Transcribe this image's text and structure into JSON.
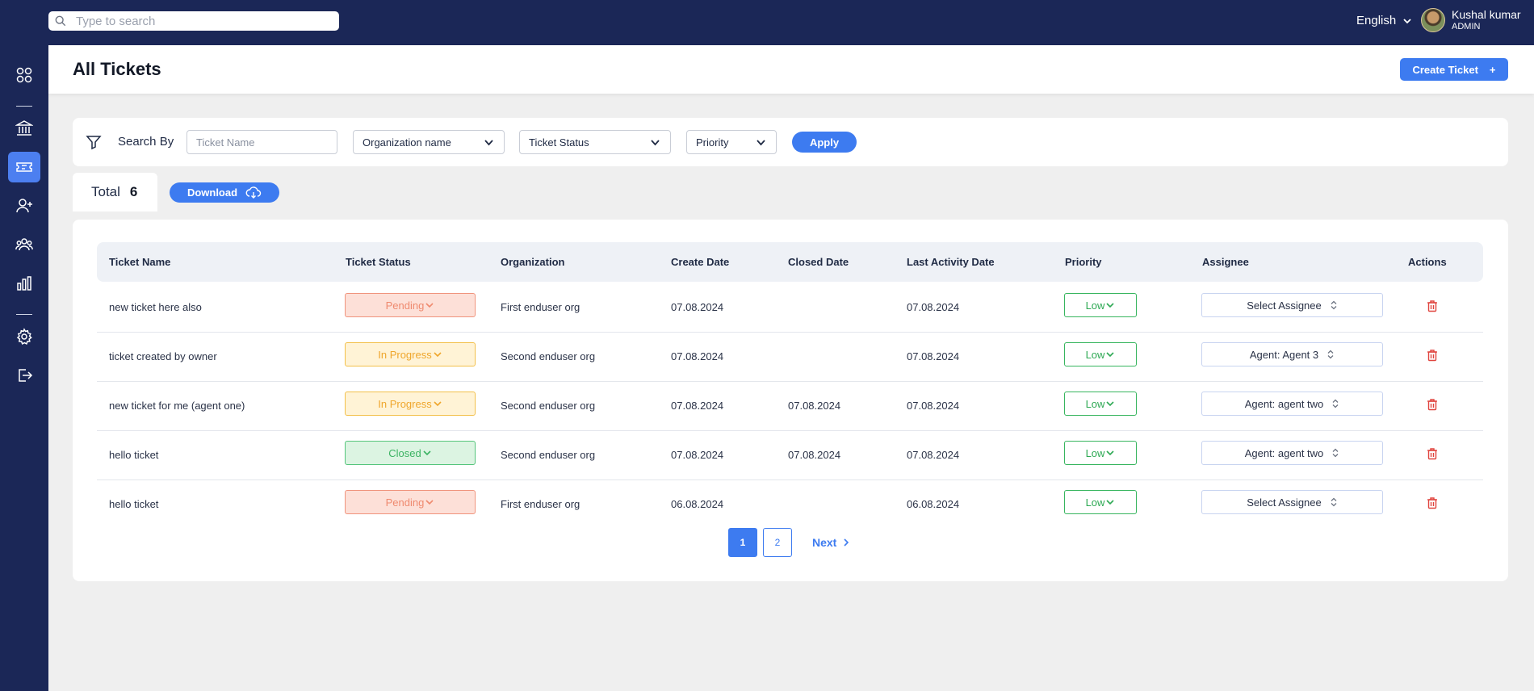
{
  "topbar": {
    "search_placeholder": "Type to search",
    "language": "English",
    "user_name": "Kushal kumar",
    "user_role": "ADMIN"
  },
  "sidebar": {
    "items": [
      {
        "icon": "grid-icon"
      },
      {
        "icon": "bank-icon"
      },
      {
        "icon": "ticket-icon",
        "active": true
      },
      {
        "icon": "user-plus-icon"
      },
      {
        "icon": "users-icon"
      },
      {
        "icon": "bar-chart-icon"
      },
      {
        "icon": "gear-icon"
      },
      {
        "icon": "logout-icon"
      }
    ]
  },
  "header": {
    "title": "All Tickets",
    "create_label": "Create Ticket",
    "create_icon": "+"
  },
  "filter": {
    "label": "Search By",
    "ticket_name_placeholder": "Ticket Name",
    "organization_select": "Organization name",
    "status_select": "Ticket Status",
    "priority_select": "Priority",
    "apply_label": "Apply"
  },
  "summary": {
    "total_label": "Total",
    "total_count": "6",
    "download_label": "Download"
  },
  "table": {
    "headers": {
      "ticket_name": "Ticket Name",
      "ticket_status": "Ticket Status",
      "organization": "Organization",
      "create_date": "Create Date",
      "closed_date": "Closed Date",
      "last_activity": "Last Activity Date",
      "priority": "Priority",
      "assignee": "Assignee",
      "actions": "Actions"
    },
    "rows": [
      {
        "name": "new ticket here also",
        "status": "Pending",
        "status_kind": "pending",
        "organization": "First enduser org",
        "create_date": "07.08.2024",
        "closed_date": "",
        "last_activity": "07.08.2024",
        "priority": "Low",
        "assignee": "Select Assignee"
      },
      {
        "name": "ticket created by owner",
        "status": "In Progress",
        "status_kind": "progress",
        "organization": "Second enduser org",
        "create_date": "07.08.2024",
        "closed_date": "",
        "last_activity": "07.08.2024",
        "priority": "Low",
        "assignee": "Agent: Agent 3"
      },
      {
        "name": "new ticket for me (agent one)",
        "status": "In Progress",
        "status_kind": "progress",
        "organization": "Second enduser org",
        "create_date": "07.08.2024",
        "closed_date": "07.08.2024",
        "last_activity": "07.08.2024",
        "priority": "Low",
        "assignee": "Agent: agent two"
      },
      {
        "name": "hello ticket",
        "status": "Closed",
        "status_kind": "closed",
        "organization": "Second enduser org",
        "create_date": "07.08.2024",
        "closed_date": "07.08.2024",
        "last_activity": "07.08.2024",
        "priority": "Low",
        "assignee": "Agent: agent two"
      },
      {
        "name": "hello ticket",
        "status": "Pending",
        "status_kind": "pending",
        "organization": "First enduser org",
        "create_date": "06.08.2024",
        "closed_date": "",
        "last_activity": "06.08.2024",
        "priority": "Low",
        "assignee": "Select Assignee"
      }
    ]
  },
  "pagination": {
    "pages": [
      "1",
      "2"
    ],
    "current": "1",
    "next_label": "Next"
  },
  "colors": {
    "navy": "#1b2757",
    "accent": "#3d7bf0",
    "pending": "#ef8a6f",
    "in_progress": "#efa62c",
    "closed": "#3cb363",
    "danger": "#e0443e"
  }
}
